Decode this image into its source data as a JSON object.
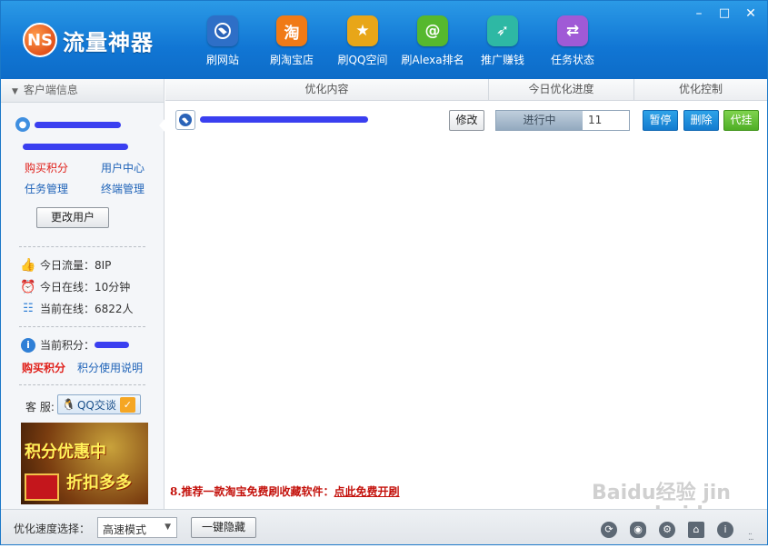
{
  "app": {
    "title": "流量神器",
    "logo_mark": "NS"
  },
  "toolbar": [
    {
      "label": "刷网站",
      "icon": "globe-icon",
      "color": "#2e6fc7"
    },
    {
      "label": "刷淘宝店",
      "icon": "taobao-icon",
      "color": "#f07a16"
    },
    {
      "label": "刷QQ空间",
      "icon": "star-icon",
      "color": "#e8a618"
    },
    {
      "label": "刷Alexa排名",
      "icon": "alexa-icon",
      "color": "#56b82e"
    },
    {
      "label": "推广赚钱",
      "icon": "rocket-icon",
      "color": "#2eb8a4"
    },
    {
      "label": "任务状态",
      "icon": "transfer-icon",
      "color": "#a05ad6"
    }
  ],
  "window_controls": {
    "minimize": "–",
    "maximize": "□",
    "close": "✕"
  },
  "sidebar": {
    "header": "客户端信息",
    "links": {
      "buy_points": "购买积分",
      "user_center": "用户中心",
      "task_manage": "任务管理",
      "terminal_manage": "终端管理"
    },
    "change_user": "更改用户",
    "stats": [
      {
        "icon": "thumb-icon",
        "text": "今日流量：8IP"
      },
      {
        "icon": "alarm-icon",
        "text": "今日在线：10分钟"
      },
      {
        "icon": "users-online-icon",
        "text": "当前在线：6822人"
      }
    ],
    "points_label": "当前积分：",
    "buy_points": "购买积分",
    "points_help": "积分使用说明",
    "service_label": "客 服:",
    "qq_button": "QQ交谈",
    "banner": {
      "line1": "积分优惠中",
      "line2": "折扣多多"
    }
  },
  "table": {
    "headers": [
      "优化内容",
      "今日优化进度",
      "优化控制"
    ],
    "row": {
      "edit": "修改",
      "progress_label": "进行中",
      "progress_count": "11",
      "pause": "暂停",
      "delete": "删除",
      "proxy": "代挂"
    }
  },
  "promo": {
    "text": "8.推荐一款淘宝免费刷收藏软件：",
    "link": "点此免费开刷"
  },
  "bottom": {
    "speed_label": "优化速度选择：",
    "speed_value": "高速模式",
    "hide_button": "一键隐藏",
    "icons": [
      "refresh-icon",
      "eye-icon",
      "settings-icon",
      "home-icon",
      "info-icon"
    ]
  },
  "watermark": "Baidu经验 jingyan.baidu.com"
}
